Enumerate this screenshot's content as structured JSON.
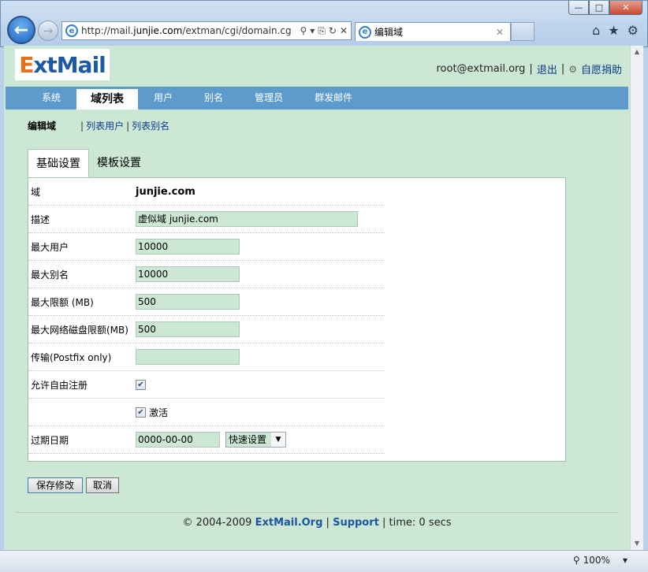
{
  "browser": {
    "url_prefix": "http://mail.",
    "url_host": "junjie.com",
    "url_rest": "/extman/cgi/domain.cg",
    "tab_title": "编辑域",
    "zoom": "100%",
    "window_buttons": [
      "—",
      "□",
      "✕"
    ]
  },
  "header": {
    "logo_e": "E",
    "logo_rest": "xtMail",
    "user": "root@extmail.org",
    "logout": "退出",
    "donate": "自愿捐助"
  },
  "topnav": {
    "items": [
      {
        "label": "系统"
      },
      {
        "label": "域列表"
      },
      {
        "label": "用户"
      },
      {
        "label": "别名"
      },
      {
        "label": "管理员"
      },
      {
        "label": "群发邮件"
      }
    ],
    "active_index": 1
  },
  "subnav": {
    "current": "编辑域",
    "links": [
      "列表用户",
      "列表别名"
    ]
  },
  "form_tabs": [
    "基础设置",
    "模板设置"
  ],
  "form": {
    "domain_label": "域",
    "domain_value": "junjie.com",
    "desc_label": "描述",
    "desc_value": "虚似域 junjie.com",
    "max_users_label": "最大用户",
    "max_users_value": "10000",
    "max_alias_label": "最大别名",
    "max_alias_value": "10000",
    "quota_label": "最大限额 (MB)",
    "quota_value": "500",
    "netdisk_label": "最大网络磁盘限额(MB)",
    "netdisk_value": "500",
    "transport_label": "传输(Postfix only)",
    "transport_value": "",
    "allow_signup_label": "允许自由注册",
    "allow_signup_checked": true,
    "active_label": "激活",
    "active_checked": true,
    "expire_label": "过期日期",
    "expire_value": "0000-00-00",
    "quick_set_label": "快速设置"
  },
  "buttons": {
    "save": "保存修改",
    "cancel": "取消"
  },
  "footer": {
    "copyright": "© 2004-2009",
    "brand": "ExtMail.Org",
    "support": "Support",
    "time": "time: 0 secs"
  }
}
